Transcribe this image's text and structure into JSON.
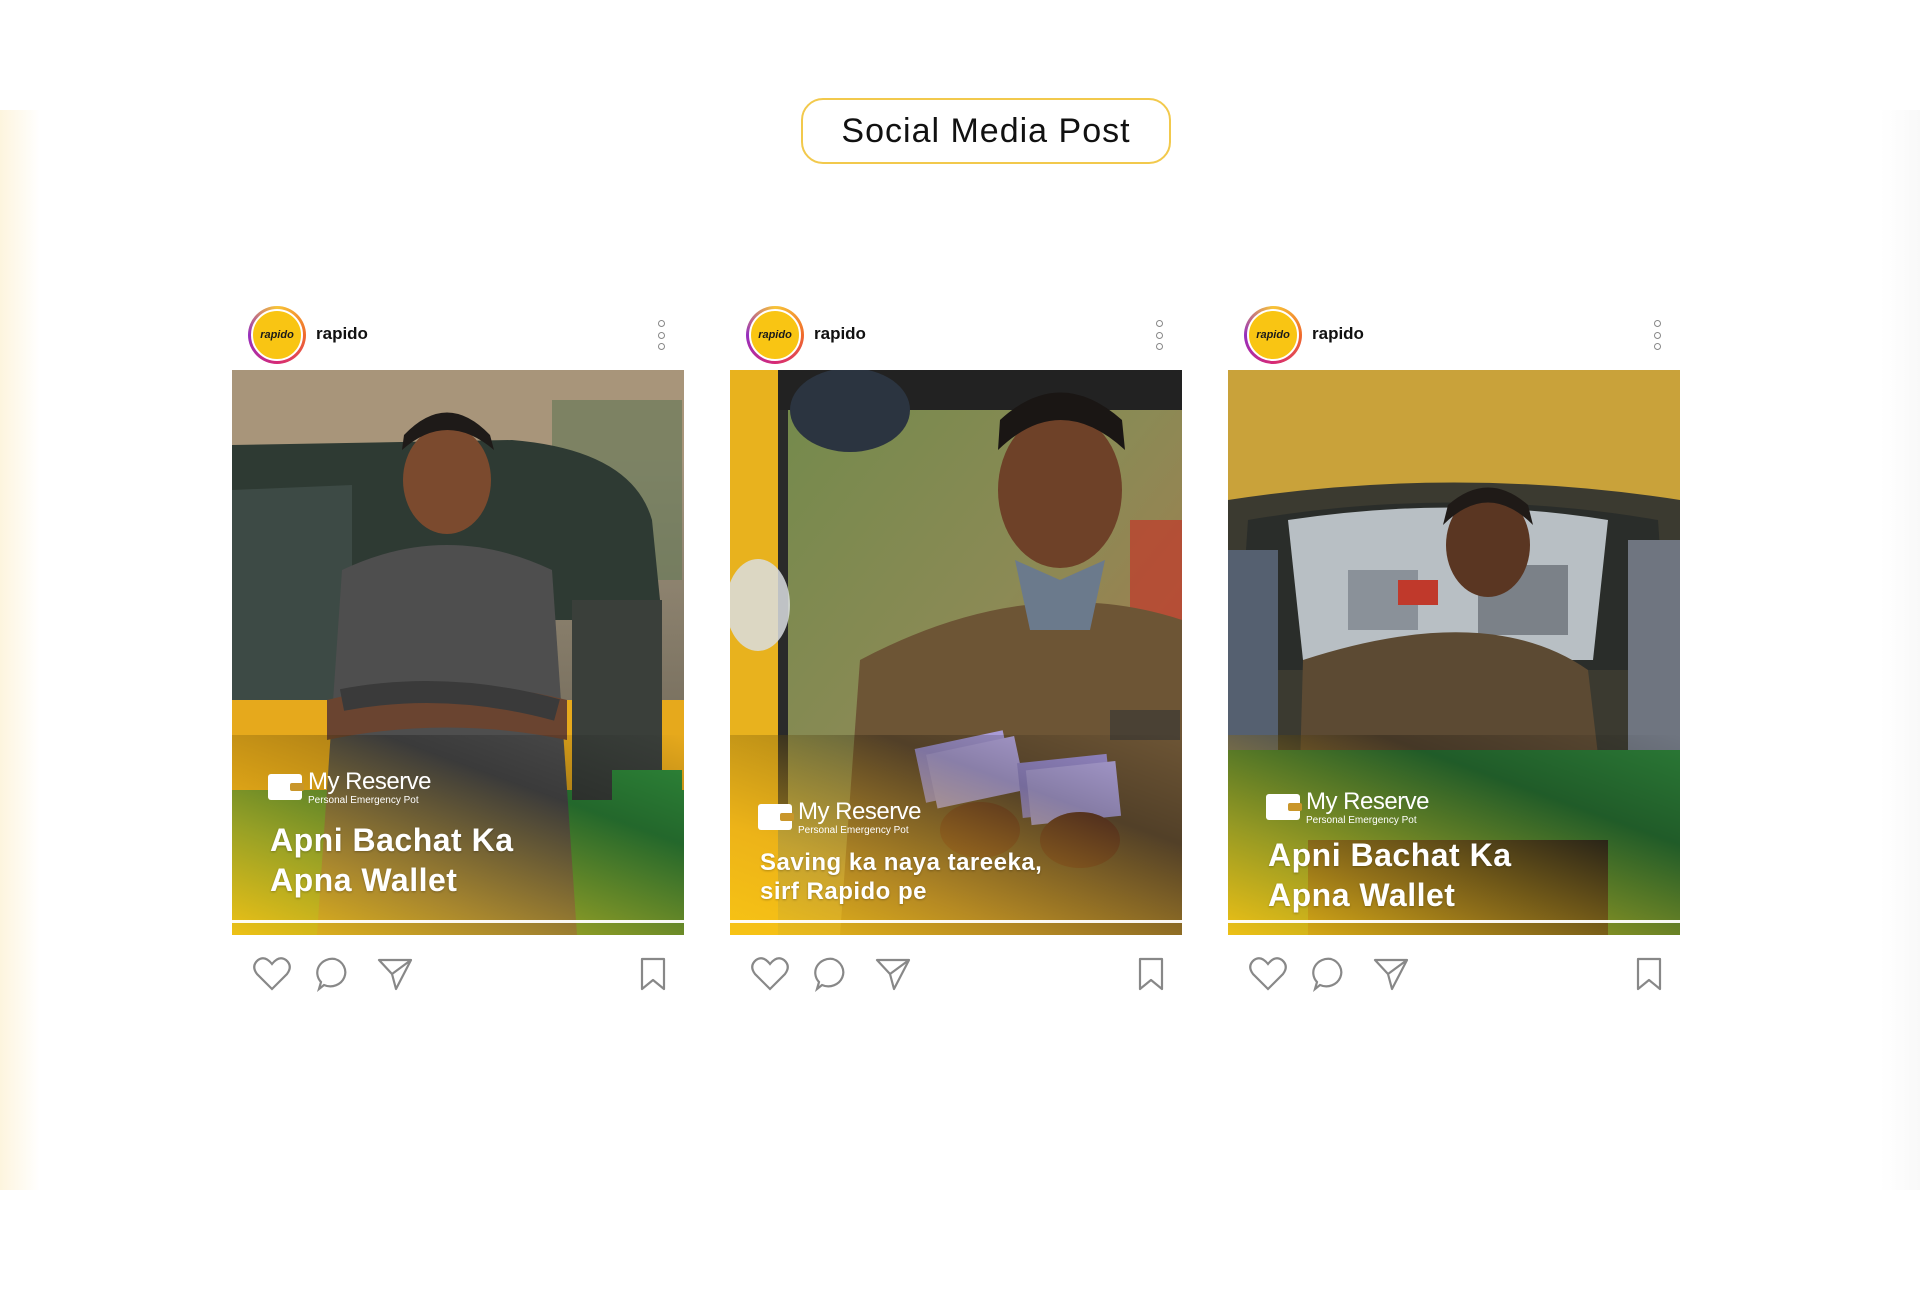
{
  "section": {
    "title": "Social Media Post"
  },
  "posts": [
    {
      "username": "rapido",
      "avatar_text": "rapido",
      "brand_name": "My Reserve",
      "brand_tagline": "Personal Emergency Pot",
      "headline_line1": "Apni Bachat Ka",
      "headline_line2": "Apna Wallet"
    },
    {
      "username": "rapido",
      "avatar_text": "rapido",
      "brand_name": "My Reserve",
      "brand_tagline": "Personal Emergency Pot",
      "headline_line1": "Saving ka naya tareeka,",
      "headline_line2": "sirf Rapido pe"
    },
    {
      "username": "rapido",
      "avatar_text": "rapido",
      "brand_name": "My Reserve",
      "brand_tagline": "Personal Emergency Pot",
      "headline_line1": "Apni Bachat Ka",
      "headline_line2": "Apna Wallet"
    }
  ],
  "icons": [
    "heart-icon",
    "comment-icon",
    "share-icon",
    "bookmark-icon",
    "more-options-icon"
  ],
  "colors": {
    "brand_yellow": "#F9C513",
    "pill_border": "#F2C94C",
    "icon_gray": "#888888"
  }
}
